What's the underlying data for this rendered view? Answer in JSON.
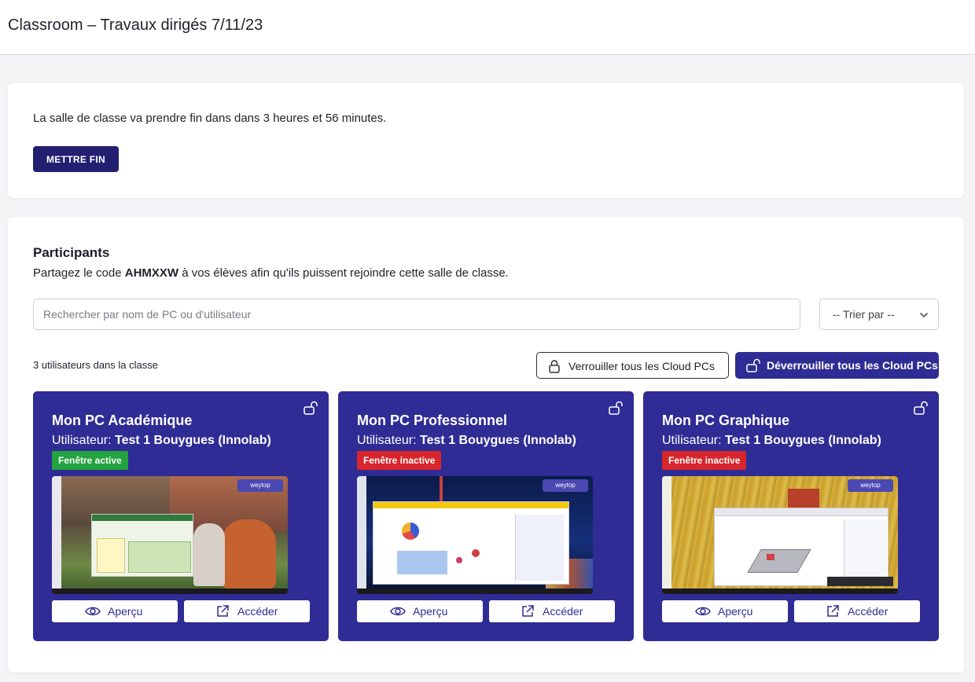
{
  "header": {
    "title": "Classroom – Travaux dirigés 7/11/23"
  },
  "session": {
    "message": "La salle de classe va prendre fin dans dans 3 heures et 56 minutes.",
    "end_button": "METTRE FIN"
  },
  "participants": {
    "title": "Participants",
    "share_prefix": "Partagez le code ",
    "code": "AHMXXW",
    "share_suffix": " à vos élèves afin qu'ils puissent rejoindre cette salle de classe.",
    "search_placeholder": "Rechercher par nom de PC ou d'utilisateur",
    "sort_label": "-- Trier par --",
    "count_text": "3 utilisateurs dans la classe",
    "lock_all": "Verrouiller tous les Cloud PCs",
    "unlock_all": "Déverrouiller tous les Cloud PCs"
  },
  "pcs": [
    {
      "name": "Mon PC Académique",
      "user_label": "Utilisateur: ",
      "user": "Test 1 Bouygues (Innolab)",
      "status": "Fenêtre active",
      "status_color": "#22a33f",
      "preview": "Aperçu",
      "access": "Accéder",
      "brand": "weytop"
    },
    {
      "name": "Mon PC Professionnel",
      "user_label": "Utilisateur: ",
      "user": "Test 1 Bouygues (Innolab)",
      "status": "Fenêtre inactive",
      "status_color": "#d7262c",
      "preview": "Aperçu",
      "access": "Accéder",
      "brand": "weytop"
    },
    {
      "name": "Mon PC Graphique",
      "user_label": "Utilisateur: ",
      "user": "Test 1 Bouygues (Innolab)",
      "status": "Fenêtre inactive",
      "status_color": "#d7262c",
      "preview": "Aperçu",
      "access": "Accéder",
      "brand": "weytop"
    }
  ],
  "colors": {
    "primary": "#2f2c95",
    "primary_dark": "#232072",
    "active": "#22a33f",
    "inactive": "#d7262c"
  }
}
